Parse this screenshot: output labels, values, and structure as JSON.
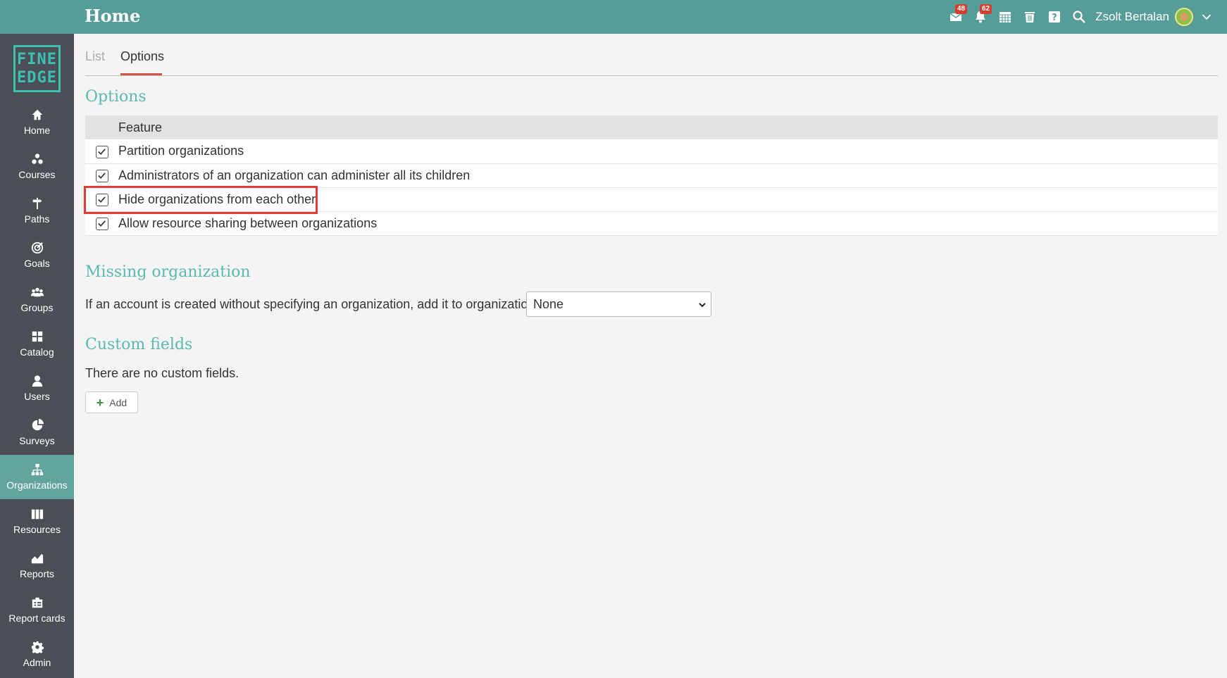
{
  "header": {
    "title": "Home",
    "messages_badge": "48",
    "notifications_badge": "62",
    "username": "Zsolt Bertalan"
  },
  "logo": {
    "line1": "FINE",
    "line2": "EDGE"
  },
  "sidebar": {
    "items": [
      {
        "label": "Home",
        "icon": "home-icon"
      },
      {
        "label": "Courses",
        "icon": "courses-icon"
      },
      {
        "label": "Paths",
        "icon": "paths-icon"
      },
      {
        "label": "Goals",
        "icon": "goals-icon"
      },
      {
        "label": "Groups",
        "icon": "groups-icon"
      },
      {
        "label": "Catalog",
        "icon": "catalog-icon"
      },
      {
        "label": "Users",
        "icon": "users-icon"
      },
      {
        "label": "Surveys",
        "icon": "surveys-icon"
      },
      {
        "label": "Organizations",
        "icon": "organizations-icon",
        "active": true
      },
      {
        "label": "Resources",
        "icon": "resources-icon"
      },
      {
        "label": "Reports",
        "icon": "reports-icon"
      },
      {
        "label": "Report cards",
        "icon": "report-cards-icon"
      },
      {
        "label": "Admin",
        "icon": "admin-icon"
      }
    ]
  },
  "tabs": {
    "list": "List",
    "options": "Options"
  },
  "options": {
    "heading": "Options",
    "column_header": "Feature",
    "rows": [
      {
        "label": "Partition organizations",
        "checked": true
      },
      {
        "label": "Administrators of an organization can administer all its children",
        "checked": true
      },
      {
        "label": "Hide organizations from each other",
        "checked": true
      },
      {
        "label": "Allow resource sharing between organizations",
        "checked": true
      }
    ]
  },
  "missing": {
    "heading": "Missing organization",
    "text": "If an account is created without specifying an organization, add it to organization:",
    "selected": "None"
  },
  "custom": {
    "heading": "Custom fields",
    "text": "There are no custom fields.",
    "add_label": "Add"
  },
  "colors": {
    "topbar": "#569d97",
    "sidebar": "#4a4f56",
    "active_nav": "#63a59e",
    "heading": "#5bb9b0",
    "highlight": "#e53935"
  }
}
